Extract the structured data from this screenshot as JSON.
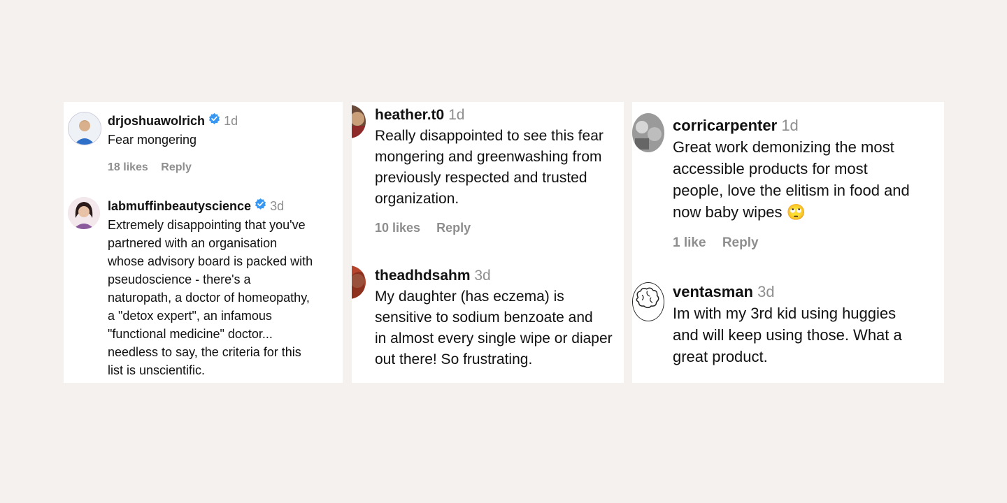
{
  "panels": [
    {
      "comments": [
        {
          "username": "drjoshuawolrich",
          "verified": true,
          "time": "1d",
          "lines": [
            "Fear mongering"
          ],
          "likes": "18 likes",
          "reply": "Reply"
        },
        {
          "username": "labmuffinbeautyscience",
          "verified": true,
          "time": "3d",
          "lines": [
            "Extremely disappointing that you've",
            "partnered with an organisation",
            "whose advisory board is packed with",
            "pseudoscience - there's a",
            "naturopath, a doctor of homeopathy,",
            "a \"detox expert\", an infamous",
            "\"functional medicine\" doctor...",
            "needless to say, the criteria for this",
            "list is unscientific."
          ]
        }
      ]
    },
    {
      "comments": [
        {
          "username": "heather.t0",
          "time": "1d",
          "lines": [
            "Really disappointed to see this fear",
            "mongering and greenwashing from",
            "previously respected and trusted",
            "organization."
          ],
          "likes": "10 likes",
          "reply": "Reply"
        },
        {
          "username": "theadhdsahm",
          "time": "3d",
          "lines": [
            "My daughter (has eczema) is",
            "sensitive to sodium benzoate and",
            "in almost every single wipe or diaper",
            "out there! So frustrating."
          ]
        }
      ]
    },
    {
      "comments": [
        {
          "username": "corricarpenter",
          "time": "1d",
          "lines": [
            "Great work demonizing the most",
            "accessible products for most",
            "people, love the elitism in food and",
            "now baby wipes 🙄"
          ],
          "likes": "1 like",
          "reply": "Reply"
        },
        {
          "username": "ventasman",
          "time": "3d",
          "lines": [
            "Im with my 3rd kid using huggies",
            "and will keep using those. What a",
            "great product."
          ]
        }
      ]
    }
  ]
}
